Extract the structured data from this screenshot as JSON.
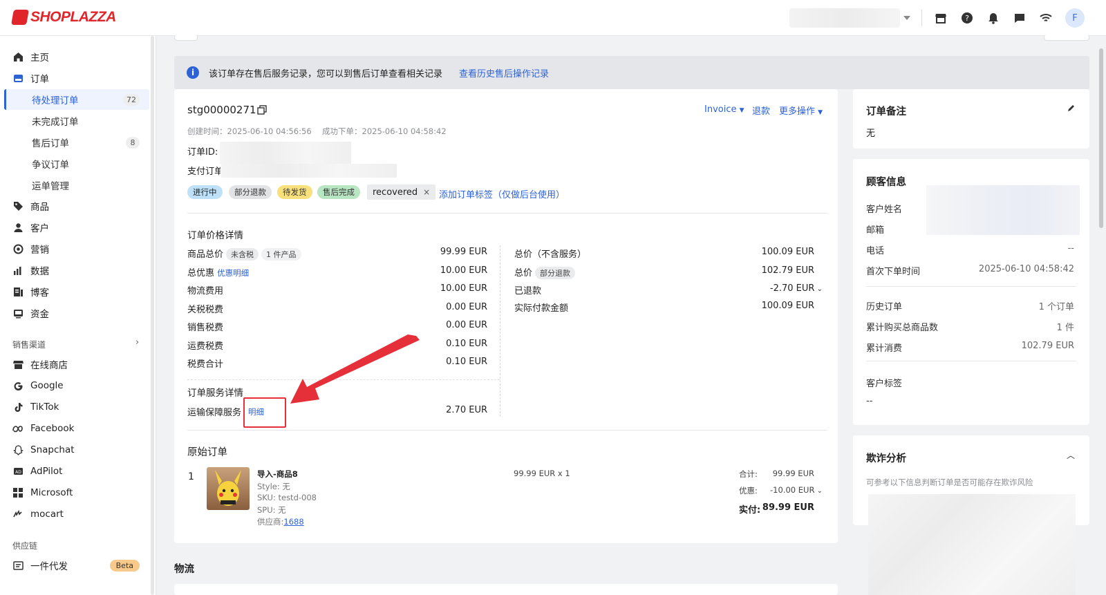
{
  "topbar": {
    "logo_text": "SHOPLAZZA",
    "avatar_letter": "F"
  },
  "sidebar": {
    "home": "主页",
    "orders": "订单",
    "order_subs": [
      {
        "label": "待处理订单",
        "count": "72",
        "active": true
      },
      {
        "label": "未完成订单",
        "count": ""
      },
      {
        "label": "售后订单",
        "count": "8"
      },
      {
        "label": "争议订单",
        "count": ""
      },
      {
        "label": "运单管理",
        "count": ""
      }
    ],
    "items": [
      "商品",
      "客户",
      "营销",
      "数据",
      "博客",
      "资金"
    ],
    "channels_label": "销售渠道",
    "channels": [
      "在线商店",
      "Google",
      "TikTok",
      "Facebook",
      "Snapchat",
      "AdPilot",
      "Microsoft",
      "mocart"
    ],
    "supply_label": "供应链",
    "supply_item": "一件代发",
    "beta": "Beta"
  },
  "notice": {
    "text": "该订单存在售后服务记录，您可以到售后订单查看相关记录",
    "link": "查看历史售后操作记录"
  },
  "order": {
    "number": "stg00000271",
    "invoice": "Invoice",
    "refund": "退款",
    "more": "更多操作",
    "created": "创建时间：2025-06-10 04:56:56",
    "success": "成功下单：2025-06-10 04:58:42",
    "order_id_label": "订单ID:",
    "pay_label": "支付订单",
    "tags": [
      "进行中",
      "部分退款",
      "待发货",
      "售后完成"
    ],
    "custom_tag": "recovered",
    "add_tag": "添加订单标签（仅做后台使用）"
  },
  "price": {
    "title": "订单价格详情",
    "left_rows": [
      {
        "label": "商品总价",
        "pill1": "未含税",
        "pill2": "1 件产品",
        "value": "99.99 EUR"
      },
      {
        "label": "总优惠",
        "link": "优惠明细",
        "value": "10.00 EUR"
      },
      {
        "label": "物流费用",
        "value": "10.00 EUR"
      },
      {
        "label": "关税税费",
        "value": "0.00 EUR"
      },
      {
        "label": "销售税费",
        "value": "0.00 EUR"
      },
      {
        "label": "运费税费",
        "value": "0.10 EUR"
      },
      {
        "label": "税费合计",
        "value": "0.10 EUR"
      }
    ],
    "right_rows": [
      {
        "label": "总价（不含服务）",
        "value": "100.09 EUR"
      },
      {
        "label": "总价",
        "pill": "部分退款",
        "value": "102.79 EUR"
      },
      {
        "label": "已退款",
        "value": "-2.70 EUR"
      },
      {
        "label": "实际付款金额",
        "value": "100.09 EUR"
      }
    ],
    "service_title": "订单服务详情",
    "service_label": "运输保障服务",
    "service_link": "明细",
    "service_value": "2.70 EUR"
  },
  "original": {
    "title": "原始订单",
    "index": "1",
    "name": "导入-商品8",
    "style": "Style: 无",
    "sku": "SKU: testd-008",
    "spu": "SPU: 无",
    "supplier_label": "供应商:",
    "supplier": "1688",
    "unit": "99.99 EUR x 1",
    "sum_label": "合计:",
    "sum": "99.99 EUR",
    "disc_label": "优惠:",
    "disc": "-10.00 EUR",
    "paid_label": "实付:",
    "paid": "89.99 EUR"
  },
  "logistics_title": "物流",
  "remark": {
    "title": "订单备注",
    "value": "无"
  },
  "customer": {
    "title": "顾客信息",
    "name_label": "客户姓名",
    "email_label": "邮箱",
    "phone_label": "电话",
    "phone": "--",
    "first_label": "首次下单时间",
    "first": "2025-06-10 04:58:42",
    "history_label": "历史订单",
    "history": "1 个订单",
    "total_items_label": "累计购买总商品数",
    "total_items": "1 件",
    "spend_label": "累计消费",
    "spend": "102.79 EUR",
    "tags_label": "客户标签",
    "tags": "--"
  },
  "fraud": {
    "title": "欺诈分析",
    "desc": "可参考以下信息判断订单是否可能存在欺诈风险"
  },
  "colors": {
    "accent": "#2c62d6",
    "brand": "#e0252b",
    "annotation": "#e5303a"
  }
}
